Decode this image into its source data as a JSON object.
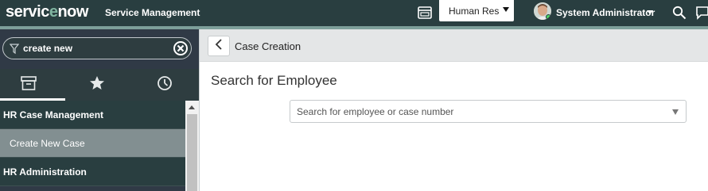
{
  "header": {
    "brand_prefix": "servic",
    "brand_o": "e",
    "brand_suffix": "now",
    "app_title": "Service Management",
    "scope_value": "Human Res",
    "user_name": "System Administrator",
    "icons": [
      "workspace-icon",
      "search-icon",
      "chat-icon"
    ]
  },
  "sidebar": {
    "filter_value": "create new",
    "tabs": [
      "archive-icon",
      "star-icon",
      "clock-icon"
    ],
    "items": [
      {
        "label": "HR Case Management"
      },
      {
        "label": "Create New Case"
      },
      {
        "label": "HR Administration"
      }
    ]
  },
  "main": {
    "page_title": "Case Creation",
    "section_heading": "Search for Employee",
    "search_placeholder": "Search for employee or case number"
  },
  "colors": {
    "header_bg": "#293e40",
    "accent": "#81b5a1",
    "active_module_bg": "#828f91"
  }
}
